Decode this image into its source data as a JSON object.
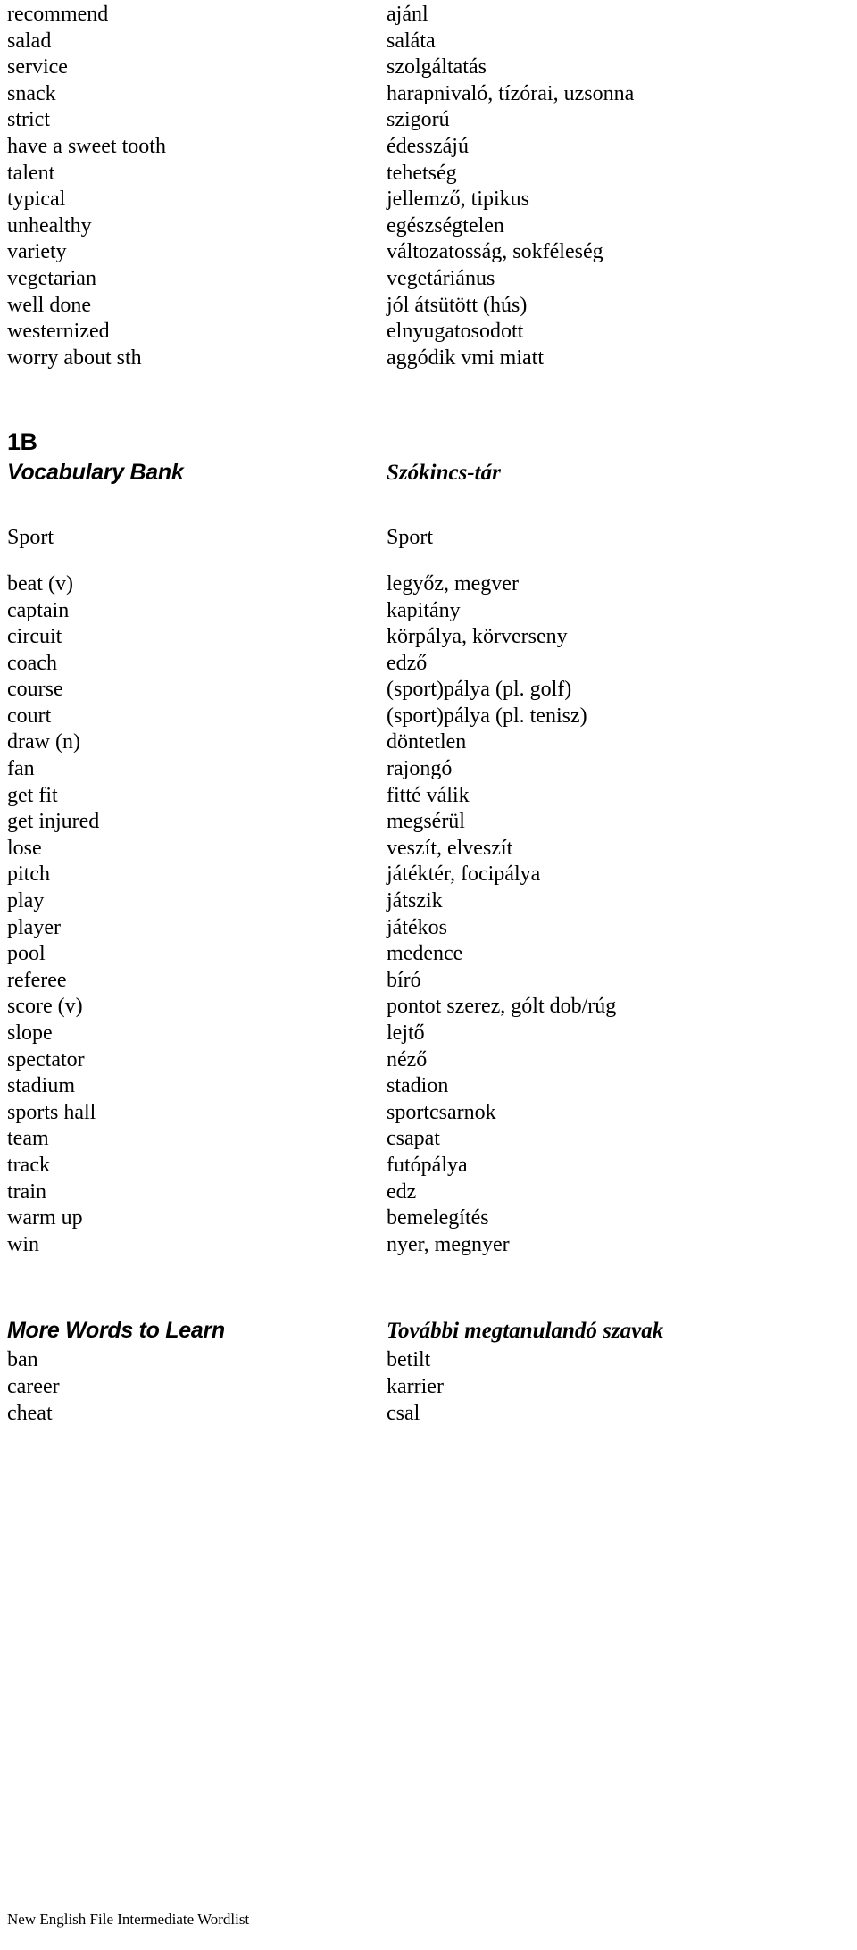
{
  "document": {
    "footer_text": "New English File Intermediate Wordlist"
  },
  "top_entries": [
    {
      "en": "recommend",
      "hu": "ajánl"
    },
    {
      "en": "salad",
      "hu": "saláta"
    },
    {
      "en": "service",
      "hu": "szolgáltatás"
    },
    {
      "en": "snack",
      "hu": "harapnivaló, tízórai, uzsonna"
    },
    {
      "en": "strict",
      "hu": "szigorú"
    },
    {
      "en": "have a sweet tooth",
      "hu": "édesszájú"
    },
    {
      "en": "talent",
      "hu": "tehetség"
    },
    {
      "en": "typical",
      "hu": "jellemző, tipikus"
    },
    {
      "en": "unhealthy",
      "hu": "egészségtelen"
    },
    {
      "en": "variety",
      "hu": "változatosság, sokféleség"
    },
    {
      "en": "vegetarian",
      "hu": "vegetáriánus"
    },
    {
      "en": "well done",
      "hu": "jól átsütött (hús)"
    },
    {
      "en": "westernized",
      "hu": "elnyugatosodott"
    },
    {
      "en": "worry about sth",
      "hu": "aggódik vmi miatt"
    }
  ],
  "unit": {
    "number": "1B",
    "heading_en": "Vocabulary Bank",
    "heading_hu": "Szókincs-tár"
  },
  "sport_group": {
    "label_en": "Sport",
    "label_hu": "Sport",
    "entries": [
      {
        "en": "beat (v)",
        "hu": "legyőz, megver"
      },
      {
        "en": "captain",
        "hu": "kapitány"
      },
      {
        "en": "circuit",
        "hu": "körpálya, körverseny"
      },
      {
        "en": "coach",
        "hu": "edző"
      },
      {
        "en": "course",
        "hu": "(sport)pálya (pl. golf)"
      },
      {
        "en": "court",
        "hu": "(sport)pálya (pl. tenisz)"
      },
      {
        "en": "draw (n)",
        "hu": "döntetlen"
      },
      {
        "en": "fan",
        "hu": "rajongó"
      },
      {
        "en": "get fit",
        "hu": "fitté válik"
      },
      {
        "en": "get injured",
        "hu": "megsérül"
      },
      {
        "en": "lose",
        "hu": "veszít, elveszít"
      },
      {
        "en": "pitch",
        "hu": "játéktér, focipálya"
      },
      {
        "en": "play",
        "hu": "játszik"
      },
      {
        "en": "player",
        "hu": "játékos"
      },
      {
        "en": "pool",
        "hu": "medence"
      },
      {
        "en": "referee",
        "hu": "bíró"
      },
      {
        "en": "score (v)",
        "hu": "pontot szerez, gólt dob/rúg"
      },
      {
        "en": "slope",
        "hu": "lejtő"
      },
      {
        "en": "spectator",
        "hu": "néző"
      },
      {
        "en": "stadium",
        "hu": "stadion"
      },
      {
        "en": "sports hall",
        "hu": "sportcsarnok"
      },
      {
        "en": "team",
        "hu": "csapat"
      },
      {
        "en": "track",
        "hu": "futópálya"
      },
      {
        "en": "train",
        "hu": "edz"
      },
      {
        "en": "warm up",
        "hu": "bemelegítés"
      },
      {
        "en": "win",
        "hu": "nyer, megnyer"
      }
    ]
  },
  "more_words": {
    "heading_en": "More Words to Learn",
    "heading_hu": "További megtanulandó szavak",
    "entries": [
      {
        "en": "ban",
        "hu": "betilt"
      },
      {
        "en": "career",
        "hu": "karrier"
      },
      {
        "en": "cheat",
        "hu": "csal"
      }
    ]
  }
}
